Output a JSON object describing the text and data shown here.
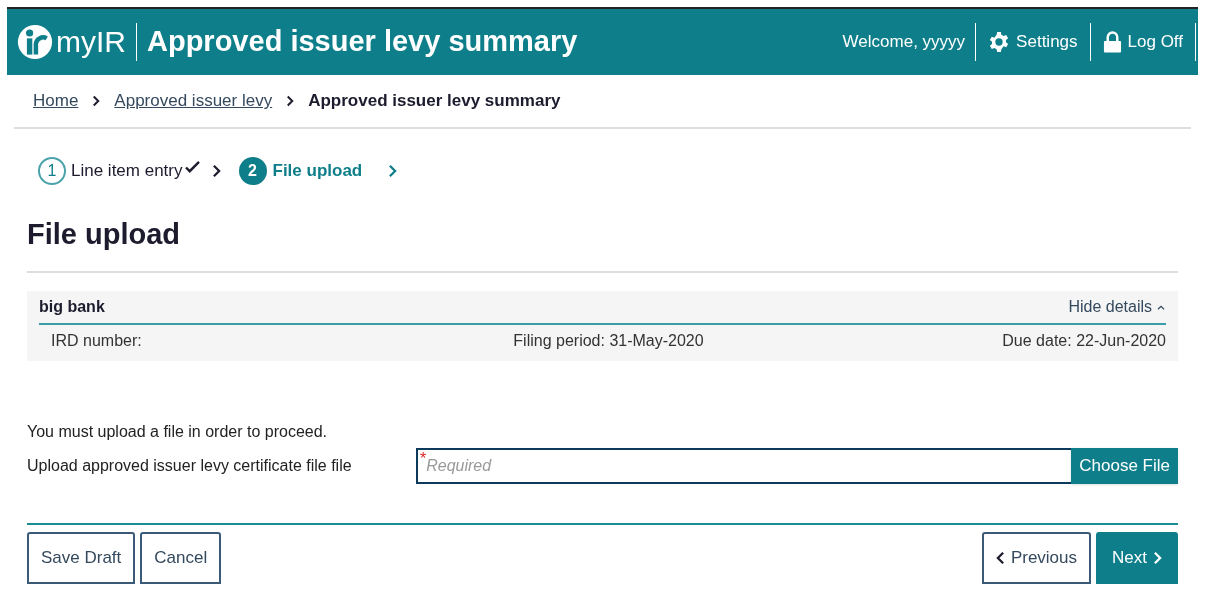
{
  "header": {
    "logo_text": "myIR",
    "title": "Approved issuer levy summary",
    "welcome": "Welcome, yyyyy",
    "settings": "Settings",
    "log_off": "Log Off"
  },
  "breadcrumbs": [
    {
      "label": "Home",
      "kind": "link"
    },
    {
      "label": "Approved issuer levy",
      "kind": "link"
    },
    {
      "label": "Approved issuer levy summary",
      "kind": "current"
    }
  ],
  "steps": [
    {
      "number": "1",
      "label": "Line item entry",
      "selected": false,
      "completed": true
    },
    {
      "number": "2",
      "label": "File upload",
      "selected": true,
      "completed": false
    }
  ],
  "heading": "File upload",
  "details": {
    "name": "big bank",
    "toggle": "Hide details",
    "expanded": true,
    "ird": "IRD number:",
    "period": "Filing period: 31-May-2020",
    "due": "Due date: 22-Jun-2020"
  },
  "notice": "You must upload a file in order to proceed.",
  "upload": {
    "label": "Upload approved issuer levy certificate file file",
    "required_mark": "*",
    "placeholder": "Required",
    "button": "Choose File"
  },
  "actions_left": [
    "Save Draft",
    "Cancel"
  ],
  "previous": "Previous",
  "next": "Next"
}
